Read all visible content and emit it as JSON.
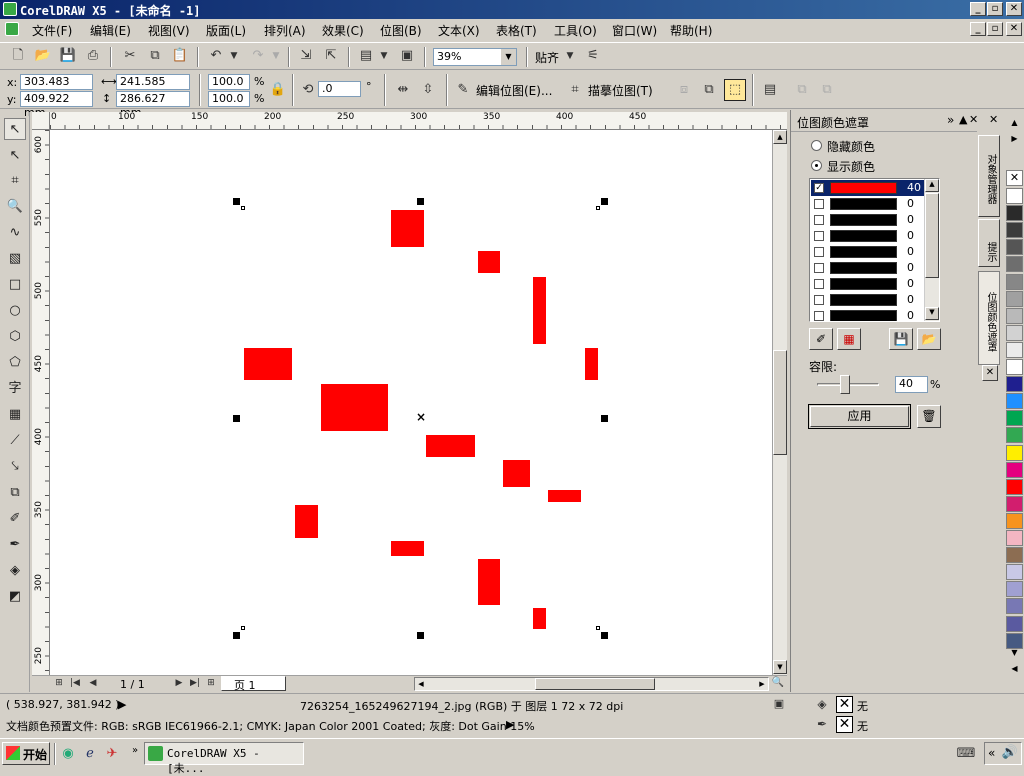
{
  "window": {
    "title": "CorelDRAW X5 - [未命名 -1]",
    "min": "_",
    "restore": "▫",
    "close": "✕"
  },
  "menu": [
    "文件(F)",
    "编辑(E)",
    "视图(V)",
    "版面(L)",
    "排列(A)",
    "效果(C)",
    "位图(B)",
    "文本(X)",
    "表格(T)",
    "工具(O)",
    "窗口(W)",
    "帮助(H)"
  ],
  "toolbar": {
    "zoom": "39%",
    "snap": "贴齐"
  },
  "props": {
    "x_label": "x:",
    "x": "303.483 mm",
    "y_label": "y:",
    "y": "409.922 mm",
    "w": "241.585 mm",
    "h": "286.627 mm",
    "sx": "100.0",
    "sy": "100.0",
    "pct": "%",
    "rot": ".0",
    "deg": "°",
    "edit_bitmap": "编辑位图(E)...",
    "trace_bitmap": "描摹位图(T)"
  },
  "hruler": [
    "0",
    "100",
    "150",
    "200",
    "250",
    "300",
    "350",
    "400",
    "450"
  ],
  "vruler": [
    "600",
    "550",
    "500",
    "450",
    "400",
    "350",
    "300",
    "250"
  ],
  "docker": {
    "title": "位图颜色遮罩",
    "hide": "隐藏颜色",
    "show": "显示颜色",
    "tolerance_label": "容限:",
    "tolerance": "40",
    "pct": "%",
    "apply": "应用",
    "rows": [
      {
        "checked": true,
        "value": "40",
        "color": "#ff0000"
      },
      {
        "checked": false,
        "value": "0",
        "color": "#000000"
      },
      {
        "checked": false,
        "value": "0",
        "color": "#000000"
      },
      {
        "checked": false,
        "value": "0",
        "color": "#000000"
      },
      {
        "checked": false,
        "value": "0",
        "color": "#000000"
      },
      {
        "checked": false,
        "value": "0",
        "color": "#000000"
      },
      {
        "checked": false,
        "value": "0",
        "color": "#000000"
      },
      {
        "checked": false,
        "value": "0",
        "color": "#000000"
      },
      {
        "checked": false,
        "value": "0",
        "color": "#000000"
      }
    ]
  },
  "docker_tabs": [
    "对象管理器",
    "提示",
    "位图颜色遮罩"
  ],
  "palette": [
    "#ffffff",
    "#2a2a2a",
    "#3c3c3c",
    "#555555",
    "#6e6e6e",
    "#878787",
    "#a0a0a0",
    "#b9b9b9",
    "#d2d2d2",
    "#ebebeb",
    "#ffffff",
    "#1f1f8f",
    "#1e90ff",
    "#00a651",
    "#32a852",
    "#ffee00",
    "#e4007f",
    "#ff0000",
    "#d21e6e",
    "#f7931e",
    "#f4b6c2",
    "#8c6d52",
    "#c8c8e6",
    "#a0a0d2",
    "#7878b4",
    "#5a5aa0",
    "#465a82"
  ],
  "scroll": {
    "page_info": "1 / 1",
    "page_tab": "页 1"
  },
  "status": {
    "coords": "( 538.927, 381.942 )",
    "object": "7263254_165249627194_2.jpg (RGB) 于 图层 1 72 x 72 dpi",
    "profile": "文档颜色预置文件: RGB: sRGB IEC61966-2.1; CMYK: Japan Color 2001 Coated; 灰度: Dot Gain 15%",
    "fill": "无",
    "outline": "无"
  },
  "taskbar": {
    "start": "开始",
    "task": "CorelDRAW X5 - [未..."
  }
}
